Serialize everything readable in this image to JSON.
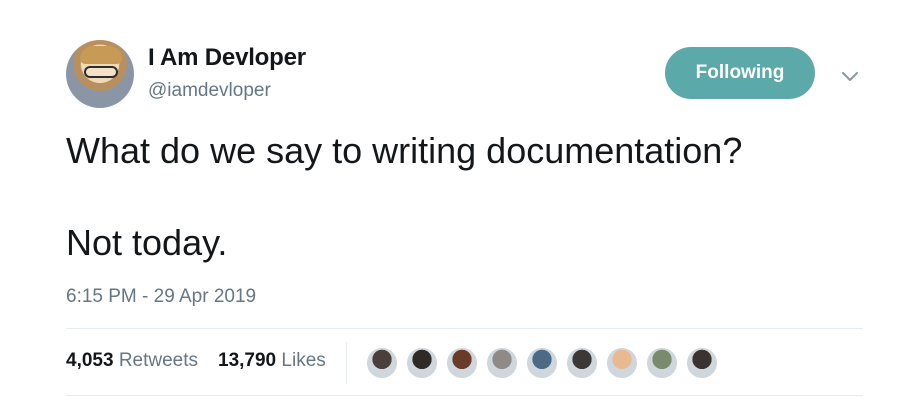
{
  "author": {
    "display_name": "I Am Devloper",
    "handle": "@iamdevloper"
  },
  "follow_button": {
    "label": "Following",
    "color": "#5ba9a8"
  },
  "tweet": {
    "lines": [
      "What do we say to writing documentation?",
      "Not today."
    ],
    "timestamp": "6:15 PM - 29 Apr 2019"
  },
  "stats": {
    "retweets": {
      "count": "4,053",
      "label": "Retweets"
    },
    "likes": {
      "count": "13,790",
      "label": "Likes"
    }
  },
  "liker_avatars": [
    {
      "color": "#4a3f3a"
    },
    {
      "color": "#2f2a26"
    },
    {
      "color": "#6b3b2a"
    },
    {
      "color": "#8f8a86"
    },
    {
      "color": "#4b6a86"
    },
    {
      "color": "#3c3835"
    },
    {
      "color": "#e9b98f"
    },
    {
      "color": "#7a8a6c"
    },
    {
      "color": "#3a3330"
    }
  ],
  "colors": {
    "text_primary": "#14171a",
    "text_secondary": "#657786",
    "divider": "#e6ecf0"
  }
}
